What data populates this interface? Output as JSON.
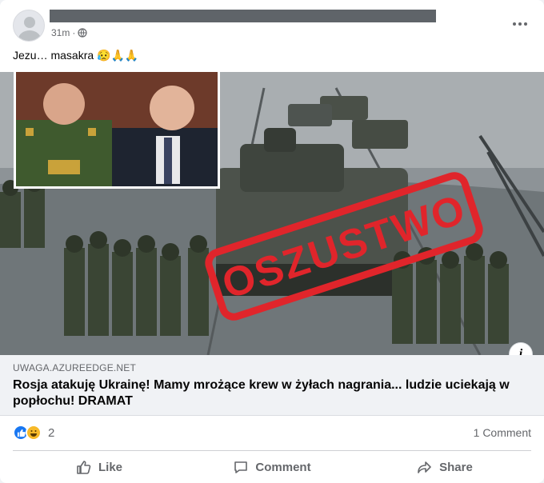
{
  "post": {
    "author_name": "",
    "time": "31m",
    "separator": "·",
    "audience_icon": "globe-icon",
    "text": "Jezu… masakra 😥🙏🙏"
  },
  "image": {
    "stamp_text": "OSZUSTWO",
    "stamp_color": "#e0252b"
  },
  "link_preview": {
    "domain": "UWAGA.AZUREEDGE.NET",
    "title": "Rosja atakuję Ukrainę! Mamy mrożące krew w żyłach nagrania... ludzie uciekają w popłochu! DRAMAT"
  },
  "reactions": {
    "count": "2",
    "types": [
      "like",
      "haha"
    ],
    "comments_label": "1 Comment"
  },
  "actions": {
    "like": "Like",
    "comment": "Comment",
    "share": "Share"
  },
  "colors": {
    "accent": "#1877f2",
    "text_secondary": "#65676b"
  }
}
